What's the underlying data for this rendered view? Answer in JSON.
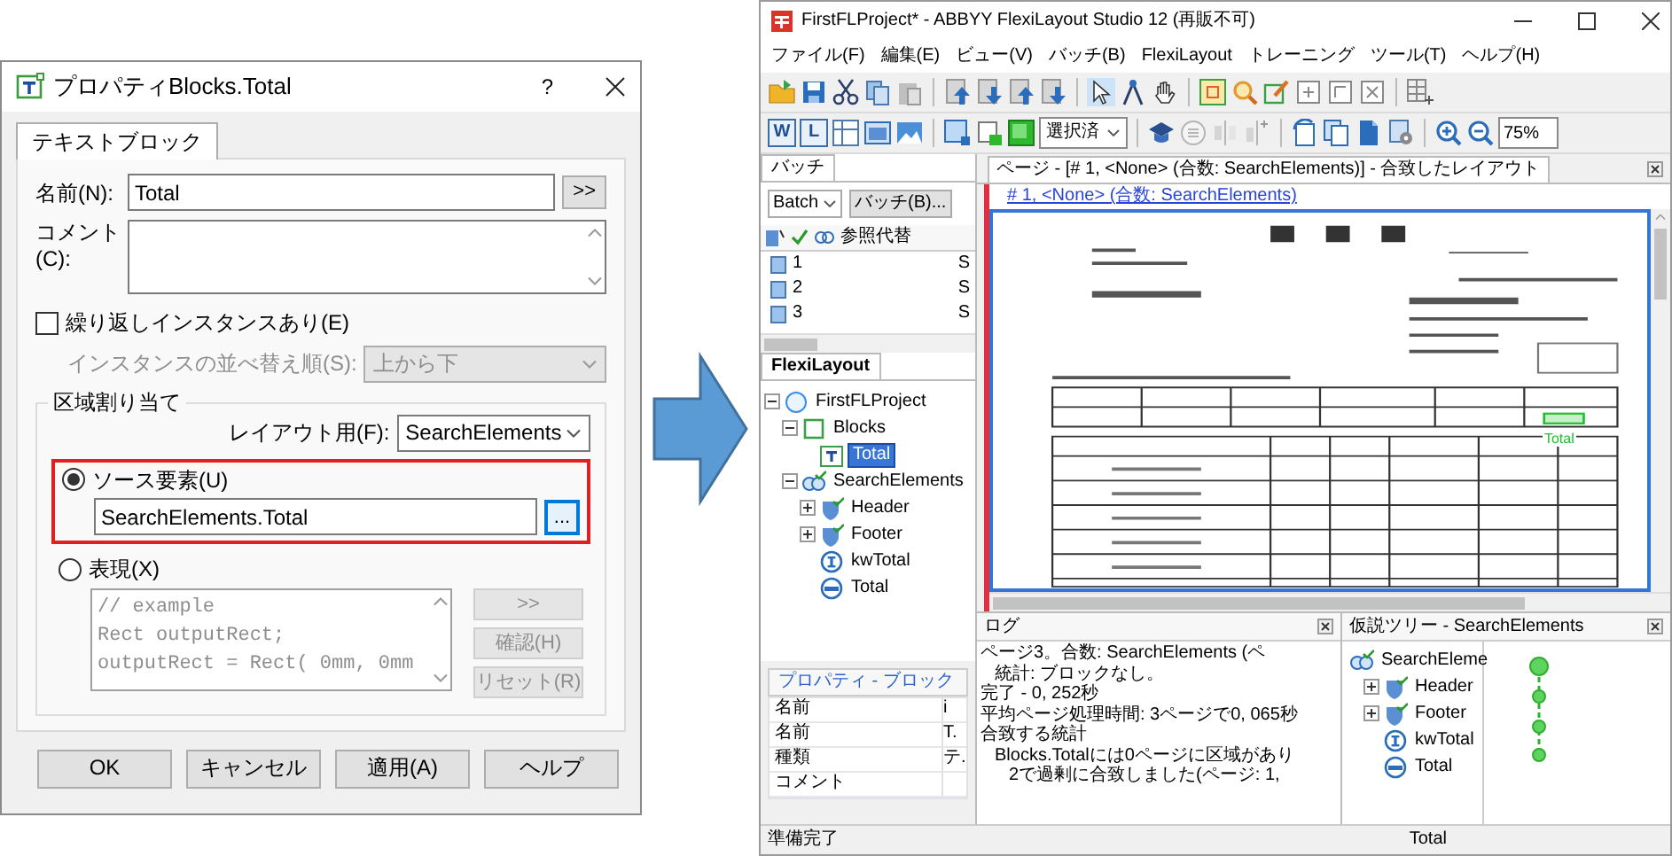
{
  "dialog": {
    "title": "プロパティBlocks.Total",
    "help": "?",
    "tabs": [
      {
        "label": "テキストブロック",
        "selected": true
      }
    ],
    "name_field": {
      "label": "名前(N):",
      "value": "Total",
      "button": ">>"
    },
    "comment_field": {
      "label": "コメント(C):"
    },
    "repeat_checkbox": {
      "label": "繰り返しインスタンスあり(E)",
      "checked": false
    },
    "sort_order": {
      "label": "インスタンスの並べ替え順(S):",
      "value": "上から下",
      "disabled": true
    },
    "region_group": {
      "title": "区域割り当て",
      "layout_label": "レイアウト用(F):",
      "layout_value": "SearchElements",
      "options": [
        {
          "kind": "source",
          "label": "ソース要素(U)",
          "selected": true,
          "highlighted": true,
          "value": "SearchElements.Total",
          "button": "..."
        },
        {
          "kind": "expression",
          "label": "表現(X)",
          "selected": false,
          "highlighted": false,
          "code": [
            "// example",
            "Rect outputRect;",
            "outputRect = Rect( 0mm, 0mm"
          ],
          "buttons": [
            {
              "label": ">>",
              "disabled": true
            },
            {
              "label": "確認(H)",
              "disabled": true
            },
            {
              "label": "リセット(R)",
              "disabled": true
            }
          ]
        }
      ]
    },
    "buttons": [
      "OK",
      "キャンセル",
      "適用(A)",
      "ヘルプ"
    ]
  },
  "window": {
    "title": "FirstFLProject* - ABBYY FlexiLayout Studio 12 (再販不可)",
    "menu": [
      "ファイル(F)",
      "編集(E)",
      "ビュー(V)",
      "バッチ(B)",
      "FlexiLayout",
      "トレーニング",
      "ツール(T)",
      "ヘルプ(H)"
    ],
    "toolbar": {
      "letter_buttons": [
        "W",
        "L"
      ],
      "selection_combo": "選択済",
      "zoom": "75%"
    },
    "batch_panel": {
      "tab": "バッチ",
      "batch_select": "Batch",
      "batch_button": "バッチ(B)...",
      "column_header": "参照代替",
      "rows": [
        {
          "label": "1",
          "column_2": "S"
        },
        {
          "label": "2",
          "column_2": "S"
        },
        {
          "label": "3",
          "column_2": "S"
        }
      ]
    },
    "flexilayout_panel": {
      "tab": "FlexiLayout",
      "tree": [
        {
          "label": "FirstFLProject",
          "kind": "project",
          "expanded": true,
          "selected": false,
          "children": [
            {
              "label": "Blocks",
              "kind": "blocks",
              "expanded": true,
              "selected": false,
              "children": [
                {
                  "label": "Total",
                  "kind": "textblock",
                  "selected": true
                }
              ]
            },
            {
              "label": "SearchElements",
              "kind": "search",
              "expanded": true,
              "selected": false,
              "children": [
                {
                  "label": "Header",
                  "kind": "compound",
                  "expanded": false,
                  "selected": false
                },
                {
                  "label": "Footer",
                  "kind": "compound",
                  "expanded": false,
                  "selected": false
                },
                {
                  "label": "kwTotal",
                  "kind": "keyword",
                  "selected": false
                },
                {
                  "label": "Total",
                  "kind": "total",
                  "selected": false
                }
              ]
            }
          ]
        }
      ]
    },
    "properties_panel": {
      "title": "プロパティ - ブロック",
      "header": {
        "name": "名前",
        "value": "i"
      },
      "rows": [
        {
          "name": "名前",
          "value": "T."
        },
        {
          "name": "種類",
          "value": "テ."
        },
        {
          "name": "コメント"
        }
      ]
    },
    "page_view": {
      "title": "ページ - [# 1, <None> (合数: SearchElements)] - 合致したレイアウト",
      "link": "# 1, <None> (合数: SearchElements)",
      "region_label": "Total"
    },
    "log_panel": {
      "title": "ログ",
      "lines": [
        {
          "text": "ページ3。合数: SearchElements (ペ",
          "children": [
            {
              "text": "統計: ブロックなし。"
            }
          ]
        },
        {
          "text": "完了 - 0, 252秒"
        },
        {
          "text": "平均ページ処理時間: 3ページで0, 065秒"
        },
        {
          "text": "合致する統計",
          "children": [
            {
              "text": "Blocks.Totalには0ページに区域があり",
              "children": [
                {
                  "text": "2で過剰に合致しました(ページ: 1,"
                }
              ]
            }
          ]
        }
      ]
    },
    "hypothesis_panel": {
      "title": "仮説ツリー - SearchElements",
      "tree": [
        {
          "label": "SearchEleme",
          "kind": "search",
          "children": [
            {
              "label": "Header",
              "kind": "compound",
              "expanded": false
            },
            {
              "label": "Footer",
              "kind": "compound",
              "expanded": false
            },
            {
              "label": "kwTotal",
              "kind": "keyword"
            },
            {
              "label": "Total",
              "kind": "total"
            }
          ]
        }
      ]
    },
    "status_bar": {
      "left": "準備完了",
      "right": "Total"
    }
  }
}
